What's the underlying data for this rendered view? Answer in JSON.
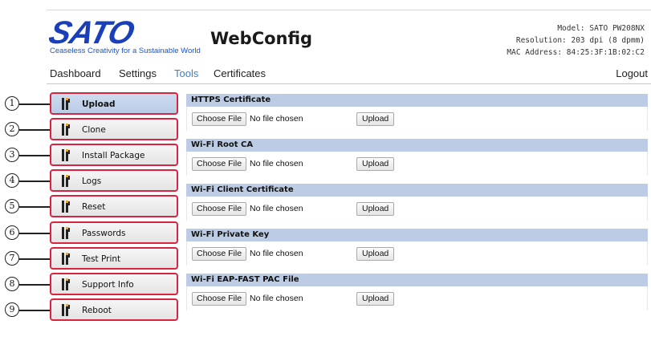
{
  "header": {
    "logo_text": "SATO",
    "tagline": "Ceaseless Creativity for a Sustainable World",
    "app_title": "WebConfig",
    "model": "Model: SATO PW208NX",
    "resolution": "Resolution: 203 dpi (8 dpmm)",
    "mac": "MAC Address: 84:25:3F:1B:02:C2"
  },
  "nav": {
    "items": [
      "Dashboard",
      "Settings",
      "Tools",
      "Certificates"
    ],
    "active": "Tools",
    "logout": "Logout"
  },
  "sidebar": {
    "items": [
      {
        "label": "Upload",
        "callout": "1",
        "active": true
      },
      {
        "label": "Clone",
        "callout": "2"
      },
      {
        "label": "Install Package",
        "callout": "3"
      },
      {
        "label": "Logs",
        "callout": "4"
      },
      {
        "label": "Reset",
        "callout": "5"
      },
      {
        "label": "Passwords",
        "callout": "6"
      },
      {
        "label": "Test Print",
        "callout": "7"
      },
      {
        "label": "Support Info",
        "callout": "8"
      },
      {
        "label": "Reboot",
        "callout": "9"
      }
    ]
  },
  "sections": [
    {
      "title": "HTTPS Certificate",
      "choose_label": "Choose File",
      "file_status": "No file chosen",
      "upload_label": "Upload"
    },
    {
      "title": "Wi-Fi Root CA",
      "choose_label": "Choose File",
      "file_status": "No file chosen",
      "upload_label": "Upload"
    },
    {
      "title": "Wi-Fi Client Certificate",
      "choose_label": "Choose File",
      "file_status": "No file chosen",
      "upload_label": "Upload"
    },
    {
      "title": "Wi-Fi Private Key",
      "choose_label": "Choose File",
      "file_status": "No file chosen",
      "upload_label": "Upload"
    },
    {
      "title": "Wi-Fi EAP-FAST PAC File",
      "choose_label": "Choose File",
      "file_status": "No file chosen",
      "upload_label": "Upload"
    }
  ],
  "colors": {
    "brand": "#1a3fb8",
    "active_nav": "#3f7fc4",
    "callout_border": "#d8243f",
    "section_header": "#bccce5",
    "icon_dark": "#222222",
    "icon_accent": "#e8a23b"
  },
  "icons": {
    "sidebar_item": "tools-icon"
  }
}
